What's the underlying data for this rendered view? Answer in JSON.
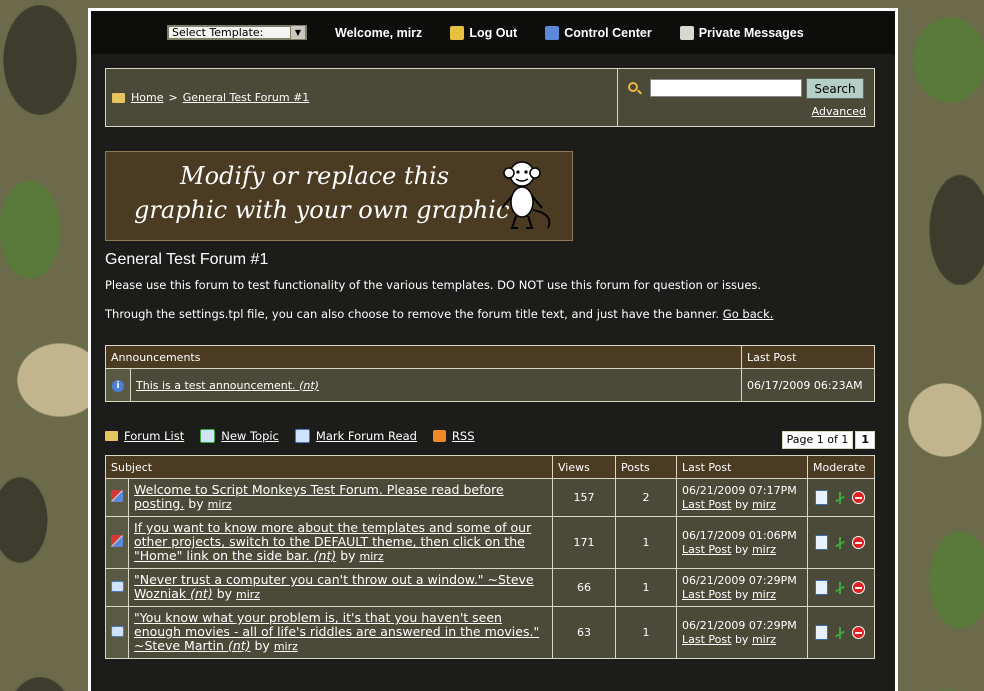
{
  "topbar": {
    "template_select": "Select Template:",
    "welcome": "Welcome, mirz",
    "logout": "Log Out",
    "control_center": "Control Center",
    "private_messages": "Private Messages"
  },
  "breadcrumb": {
    "home": "Home",
    "separator": ">",
    "current": "General Test Forum #1"
  },
  "search": {
    "button": "Search",
    "advanced": "Advanced",
    "value": ""
  },
  "banner": {
    "line1": "Modify or replace this",
    "line2": "graphic with your own graphic"
  },
  "forum": {
    "title": "General Test Forum #1",
    "desc1": "Please use this forum to test functionality of the various templates. DO NOT use this forum for question or issues.",
    "desc2": "Through the settings.tpl file, you can also choose to remove the forum title text, and just have the banner.",
    "go_back": "Go back."
  },
  "announcements": {
    "header": "Announcements",
    "last_post_header": "Last Post",
    "items": [
      {
        "title": "This is a test announcement.",
        "tag": "(nt)",
        "last_post": "06/17/2009 06:23AM"
      }
    ]
  },
  "tools": {
    "forum_list": "Forum List",
    "new_topic": "New Topic",
    "mark_read": "Mark Forum Read",
    "rss": "RSS",
    "page_label": "Page 1 of 1",
    "page_num": "1"
  },
  "threads": {
    "headers": {
      "subject": "Subject",
      "views": "Views",
      "posts": "Posts",
      "last_post": "Last Post",
      "moderate": "Moderate"
    },
    "by": "by",
    "last_post_link": "Last Post",
    "rows": [
      {
        "icon": "sticky",
        "title": "Welcome to Script Monkeys Test Forum. Please read before posting.",
        "tag": "",
        "author": "mirz",
        "views": "157",
        "posts": "2",
        "date": "06/21/2009 07:17PM",
        "last_by": "mirz"
      },
      {
        "icon": "sticky",
        "title": "If you want to know more about the templates and some of our other projects, switch to the DEFAULT theme, then click on the \"Home\" link on the side bar.",
        "tag": "(nt)",
        "author": "mirz",
        "views": "171",
        "posts": "1",
        "date": "06/17/2009 01:06PM",
        "last_by": "mirz"
      },
      {
        "icon": "thread",
        "title": "\"Never trust a computer you can't throw out a window.\" ~Steve Wozniak",
        "tag": "(nt)",
        "author": "mirz",
        "views": "66",
        "posts": "1",
        "date": "06/21/2009 07:29PM",
        "last_by": "mirz"
      },
      {
        "icon": "thread",
        "title": "\"You know what your problem is, it's that you haven't seen enough movies - all of life's riddles are answered in the movies.\" ~Steve Martin",
        "tag": "(nt)",
        "author": "mirz",
        "views": "63",
        "posts": "1",
        "date": "06/21/2009 07:29PM",
        "last_by": "mirz"
      }
    ]
  },
  "colors": {
    "header_bg": "#4a3b22",
    "row_bg": "#4b4a39",
    "border": "#d9d7c3"
  }
}
